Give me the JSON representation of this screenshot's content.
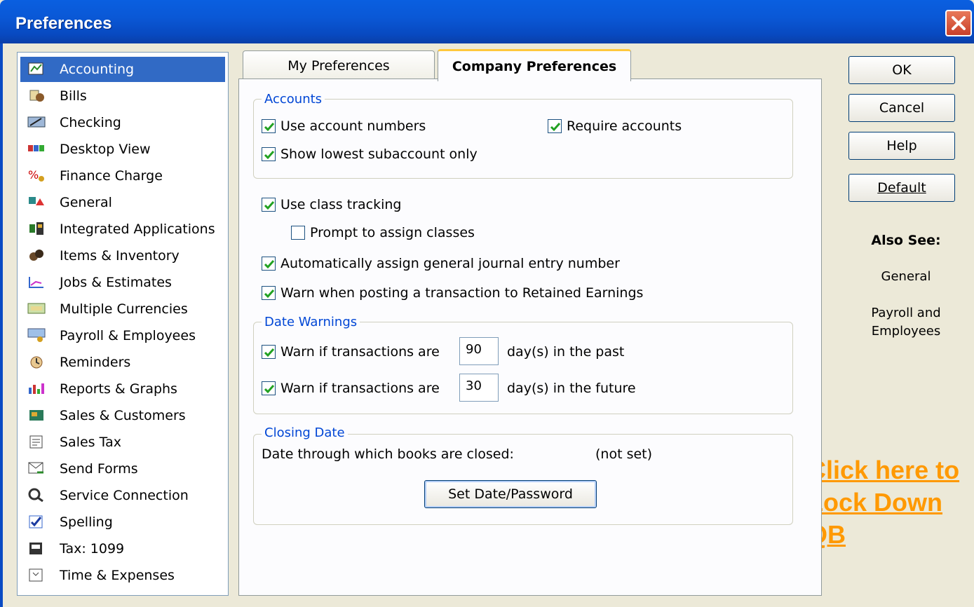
{
  "window": {
    "title": "Preferences"
  },
  "categories": [
    {
      "label": "Accounting",
      "icon": "accounting-icon",
      "selected": true
    },
    {
      "label": "Bills",
      "icon": "bills-icon"
    },
    {
      "label": "Checking",
      "icon": "checking-icon"
    },
    {
      "label": "Desktop View",
      "icon": "desktop-view-icon"
    },
    {
      "label": "Finance Charge",
      "icon": "finance-charge-icon"
    },
    {
      "label": "General",
      "icon": "general-icon"
    },
    {
      "label": "Integrated Applications",
      "icon": "integrated-applications-icon"
    },
    {
      "label": "Items & Inventory",
      "icon": "items-inventory-icon"
    },
    {
      "label": "Jobs & Estimates",
      "icon": "jobs-estimates-icon"
    },
    {
      "label": "Multiple Currencies",
      "icon": "multiple-currencies-icon"
    },
    {
      "label": "Payroll & Employees",
      "icon": "payroll-employees-icon"
    },
    {
      "label": "Reminders",
      "icon": "reminders-icon"
    },
    {
      "label": "Reports & Graphs",
      "icon": "reports-graphs-icon"
    },
    {
      "label": "Sales & Customers",
      "icon": "sales-customers-icon"
    },
    {
      "label": "Sales Tax",
      "icon": "sales-tax-icon"
    },
    {
      "label": "Send Forms",
      "icon": "send-forms-icon"
    },
    {
      "label": "Service Connection",
      "icon": "service-connection-icon"
    },
    {
      "label": "Spelling",
      "icon": "spelling-icon"
    },
    {
      "label": "Tax: 1099",
      "icon": "tax-1099-icon"
    },
    {
      "label": "Time & Expenses",
      "icon": "time-expenses-icon"
    }
  ],
  "tabs": {
    "my_preferences": "My Preferences",
    "company_preferences": "Company Preferences",
    "active": "company_preferences"
  },
  "accounts": {
    "title": "Accounts",
    "use_account_numbers": {
      "label": "Use account numbers",
      "checked": true
    },
    "require_accounts": {
      "label": "Require accounts",
      "checked": true
    },
    "show_lowest_subaccount": {
      "label": "Show lowest subaccount only",
      "checked": true
    }
  },
  "options": {
    "use_class_tracking": {
      "label": "Use class tracking",
      "checked": true
    },
    "prompt_assign_classes": {
      "label": "Prompt to assign classes",
      "checked": false
    },
    "auto_assign_journal": {
      "label": "Automatically assign general journal entry number",
      "checked": true
    },
    "warn_retained_earnings": {
      "label": "Warn when posting a transaction to Retained Earnings",
      "checked": true
    }
  },
  "date_warnings": {
    "title": "Date Warnings",
    "past": {
      "prefix": "Warn if transactions are",
      "value": "90",
      "suffix": "day(s) in the past",
      "checked": true
    },
    "future": {
      "prefix": "Warn if transactions are",
      "value": "30",
      "suffix": "day(s) in the future",
      "checked": true
    }
  },
  "closing_date": {
    "title": "Closing Date",
    "label": "Date through which books are closed:",
    "value": "(not set)",
    "button": "Set Date/Password"
  },
  "buttons": {
    "ok": "OK",
    "cancel": "Cancel",
    "help": "Help",
    "default": "Default"
  },
  "also_see": {
    "title": "Also See:",
    "link_general": "General",
    "link_payroll_1": "Payroll and",
    "link_payroll_2": "Employees"
  },
  "annotation": {
    "line1": "Click here to",
    "line2": "Lock Down",
    "line3": "QB"
  },
  "colors": {
    "title_bar": "#0A58D6",
    "selection": "#316AC5",
    "group_title": "#0046D5",
    "annotation": "#FF9900"
  }
}
